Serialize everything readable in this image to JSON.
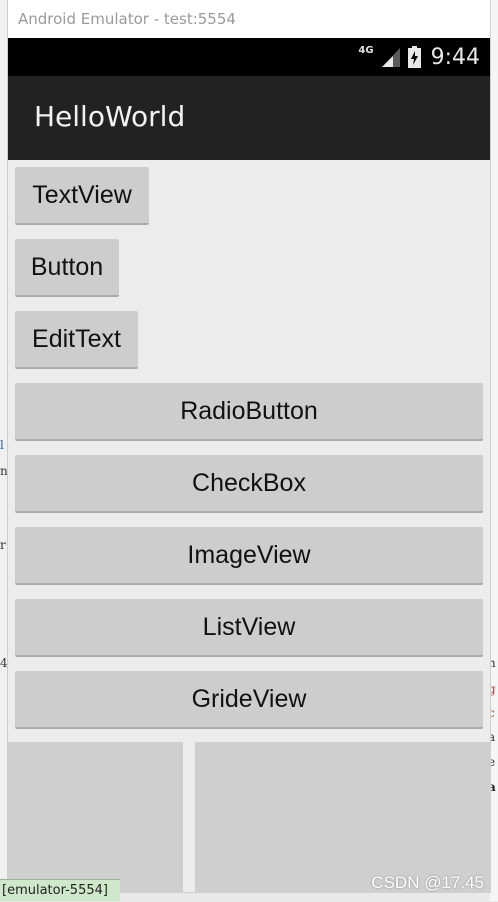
{
  "window": {
    "title": "Android Emulator - test:5554"
  },
  "status_bar": {
    "network_type": "4G",
    "time": "9:44",
    "signal_icon": "signal-icon",
    "battery_icon": "battery-charging-icon"
  },
  "action_bar": {
    "title": "HelloWorld"
  },
  "buttons": {
    "textview": "TextView",
    "button": "Button",
    "edittext": "EditText",
    "radiobutton": "RadioButton",
    "checkbox": "CheckBox",
    "imageview": "ImageView",
    "listview": "ListView",
    "grideview": "GrideView"
  },
  "background": {
    "taskbar_item": "[emulator-5554]",
    "watermark": "CSDN @17.45"
  },
  "colors": {
    "status_bar": "#000000",
    "action_bar": "#222222",
    "content_bg": "#ececec",
    "button_bg": "#cdcdcd"
  }
}
